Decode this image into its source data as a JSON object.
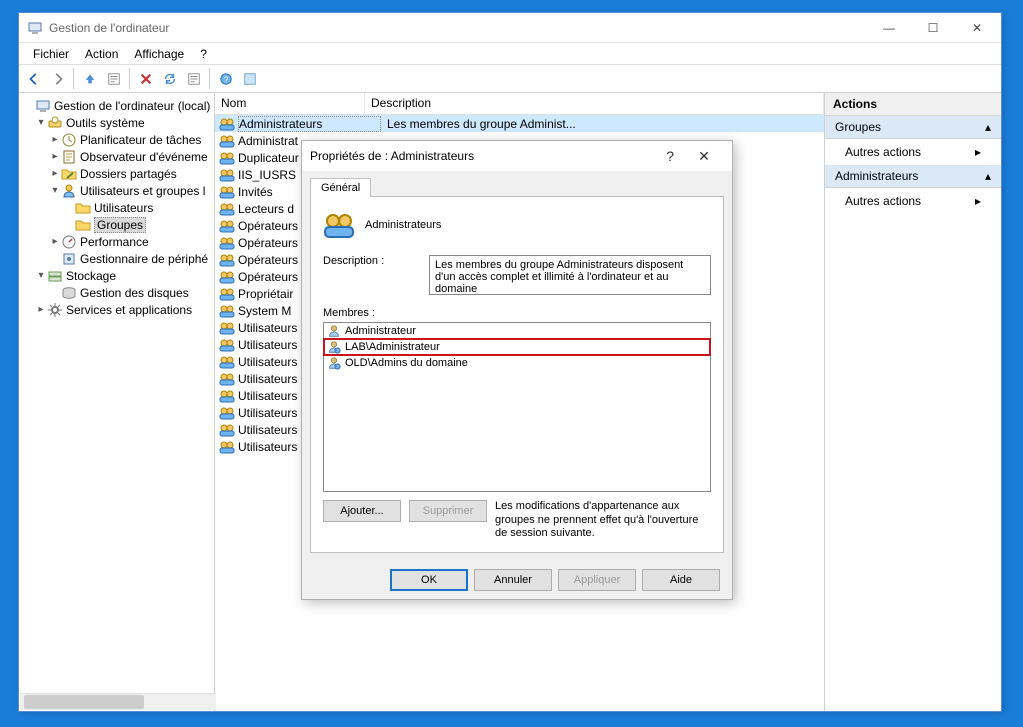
{
  "window": {
    "title": "Gestion de l'ordinateur",
    "menu": [
      "Fichier",
      "Action",
      "Affichage",
      "?"
    ]
  },
  "tree": {
    "root": "Gestion de l'ordinateur (local)",
    "outils": "Outils système",
    "planif": "Planificateur de tâches",
    "observ": "Observateur d'événeme",
    "dossiers": "Dossiers partagés",
    "ugroups": "Utilisateurs et groupes l",
    "users": "Utilisateurs",
    "groups": "Groupes",
    "perf": "Performance",
    "devmgr": "Gestionnaire de périphé",
    "storage": "Stockage",
    "diskmgr": "Gestion des disques",
    "services": "Services et applications"
  },
  "list": {
    "col_name": "Nom",
    "col_desc": "Description",
    "rows": [
      {
        "name": "Administrateurs",
        "desc": "Les membres du groupe Administ..."
      },
      {
        "name": "Administrat",
        "desc": ""
      },
      {
        "name": "Duplicateur",
        "desc": ""
      },
      {
        "name": "IIS_IUSRS",
        "desc": ""
      },
      {
        "name": "Invités",
        "desc": ""
      },
      {
        "name": "Lecteurs d",
        "desc": ""
      },
      {
        "name": "Opérateurs",
        "desc": ""
      },
      {
        "name": "Opérateurs",
        "desc": ""
      },
      {
        "name": "Opérateurs",
        "desc": ""
      },
      {
        "name": "Opérateurs",
        "desc": ""
      },
      {
        "name": "Propriétair",
        "desc": ""
      },
      {
        "name": "System M",
        "desc": ""
      },
      {
        "name": "Utilisateurs",
        "desc": ""
      },
      {
        "name": "Utilisateurs",
        "desc": ""
      },
      {
        "name": "Utilisateurs",
        "desc": ""
      },
      {
        "name": "Utilisateurs",
        "desc": ""
      },
      {
        "name": "Utilisateurs",
        "desc": ""
      },
      {
        "name": "Utilisateurs",
        "desc": ""
      },
      {
        "name": "Utilisateurs",
        "desc": ""
      },
      {
        "name": "Utilisateurs",
        "desc": ""
      }
    ]
  },
  "actions": {
    "header": "Actions",
    "sec1": "Groupes",
    "item": "Autres actions",
    "sec2": "Administrateurs"
  },
  "dialog": {
    "title": "Propriétés de : Administrateurs",
    "tab": "Général",
    "group_name": "Administrateurs",
    "desc_label": "Description :",
    "description": "Les membres du groupe Administrateurs disposent d'un accès complet et illimité à l'ordinateur et au domaine",
    "members_label": "Membres :",
    "members": [
      "Administrateur",
      "LAB\\Administrateur",
      "OLD\\Admins du domaine"
    ],
    "add": "Ajouter...",
    "remove": "Supprimer",
    "note": "Les modifications d'appartenance aux groupes ne prennent effet qu'à l'ouverture de session suivante.",
    "ok": "OK",
    "cancel": "Annuler",
    "apply": "Appliquer",
    "help": "Aide"
  }
}
